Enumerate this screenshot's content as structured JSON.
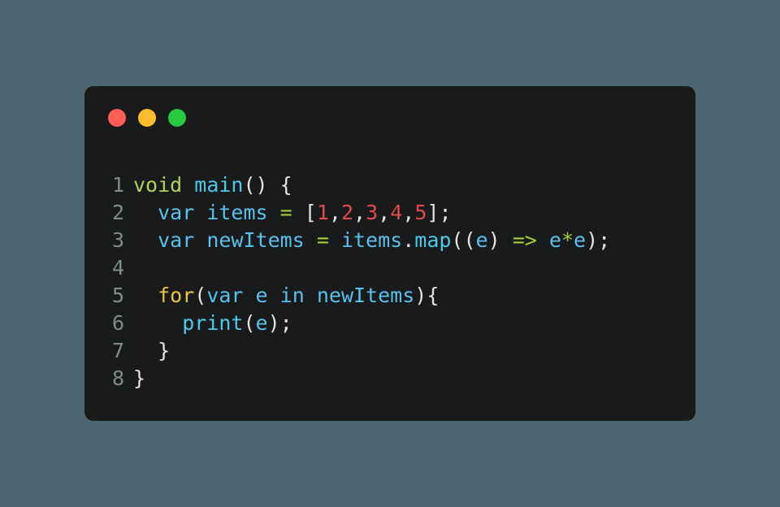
{
  "page": {
    "background_color": "#4c6773"
  },
  "window": {
    "background_color": "#181a1b",
    "traffic_lights": [
      {
        "name": "close",
        "color": "#ff5f56"
      },
      {
        "name": "minimize",
        "color": "#ffbd2e"
      },
      {
        "name": "maximize",
        "color": "#27c93f"
      }
    ]
  },
  "editor": {
    "language": "dart",
    "line_number_color": "#7d8d88",
    "palette": {
      "plain": "#e3e3e3",
      "type": "#b5ce5b",
      "function": "#4ec9e8",
      "variable": "#5bc0eb",
      "operator": "#a6ce39",
      "number": "#e04c4c",
      "keyword": "#e8c547"
    },
    "line_numbers": [
      "1",
      "2",
      "3",
      "4",
      "5",
      "6",
      "7",
      "8"
    ],
    "lines": [
      {
        "number": "1",
        "text": "void main() {",
        "tokens": [
          {
            "t": "void",
            "c": "type"
          },
          {
            "t": " ",
            "c": "plain"
          },
          {
            "t": "main",
            "c": "function"
          },
          {
            "t": "() {",
            "c": "punct"
          }
        ]
      },
      {
        "number": "2",
        "text": "  var items = [1,2,3,4,5];",
        "tokens": [
          {
            "t": "  ",
            "c": "plain"
          },
          {
            "t": "var",
            "c": "variable"
          },
          {
            "t": " ",
            "c": "plain"
          },
          {
            "t": "items",
            "c": "variable"
          },
          {
            "t": " ",
            "c": "plain"
          },
          {
            "t": "=",
            "c": "operator"
          },
          {
            "t": " [",
            "c": "punct"
          },
          {
            "t": "1",
            "c": "number"
          },
          {
            "t": ",",
            "c": "punct"
          },
          {
            "t": "2",
            "c": "number"
          },
          {
            "t": ",",
            "c": "punct"
          },
          {
            "t": "3",
            "c": "number"
          },
          {
            "t": ",",
            "c": "punct"
          },
          {
            "t": "4",
            "c": "number"
          },
          {
            "t": ",",
            "c": "punct"
          },
          {
            "t": "5",
            "c": "number"
          },
          {
            "t": "];",
            "c": "punct"
          }
        ]
      },
      {
        "number": "3",
        "text": "  var newItems = items.map((e) => e*e);",
        "tokens": [
          {
            "t": "  ",
            "c": "plain"
          },
          {
            "t": "var",
            "c": "variable"
          },
          {
            "t": " ",
            "c": "plain"
          },
          {
            "t": "newItems",
            "c": "variable"
          },
          {
            "t": " ",
            "c": "plain"
          },
          {
            "t": "=",
            "c": "operator"
          },
          {
            "t": " ",
            "c": "plain"
          },
          {
            "t": "items",
            "c": "variable"
          },
          {
            "t": ".",
            "c": "punct"
          },
          {
            "t": "map",
            "c": "method"
          },
          {
            "t": "((",
            "c": "punct"
          },
          {
            "t": "e",
            "c": "variable"
          },
          {
            "t": ") ",
            "c": "punct"
          },
          {
            "t": "=>",
            "c": "operator"
          },
          {
            "t": " ",
            "c": "plain"
          },
          {
            "t": "e",
            "c": "variable"
          },
          {
            "t": "*",
            "c": "operator"
          },
          {
            "t": "e",
            "c": "variable"
          },
          {
            "t": ");",
            "c": "punct"
          }
        ]
      },
      {
        "number": "4",
        "text": "",
        "tokens": []
      },
      {
        "number": "5",
        "text": "  for(var e in newItems){",
        "tokens": [
          {
            "t": "  ",
            "c": "plain"
          },
          {
            "t": "for",
            "c": "keyword"
          },
          {
            "t": "(",
            "c": "punct"
          },
          {
            "t": "var",
            "c": "variable"
          },
          {
            "t": " ",
            "c": "plain"
          },
          {
            "t": "e",
            "c": "variable"
          },
          {
            "t": " ",
            "c": "plain"
          },
          {
            "t": "in",
            "c": "variable"
          },
          {
            "t": " ",
            "c": "plain"
          },
          {
            "t": "newItems",
            "c": "variable"
          },
          {
            "t": "){",
            "c": "punct"
          }
        ]
      },
      {
        "number": "6",
        "text": "    print(e);",
        "tokens": [
          {
            "t": "    ",
            "c": "plain"
          },
          {
            "t": "print",
            "c": "method"
          },
          {
            "t": "(",
            "c": "punct"
          },
          {
            "t": "e",
            "c": "variable"
          },
          {
            "t": ");",
            "c": "punct"
          }
        ]
      },
      {
        "number": "7",
        "text": "  }",
        "tokens": [
          {
            "t": "  ",
            "c": "plain"
          },
          {
            "t": "}",
            "c": "punct"
          }
        ]
      },
      {
        "number": "8",
        "text": "}",
        "tokens": [
          {
            "t": "}",
            "c": "punct"
          }
        ]
      }
    ]
  }
}
